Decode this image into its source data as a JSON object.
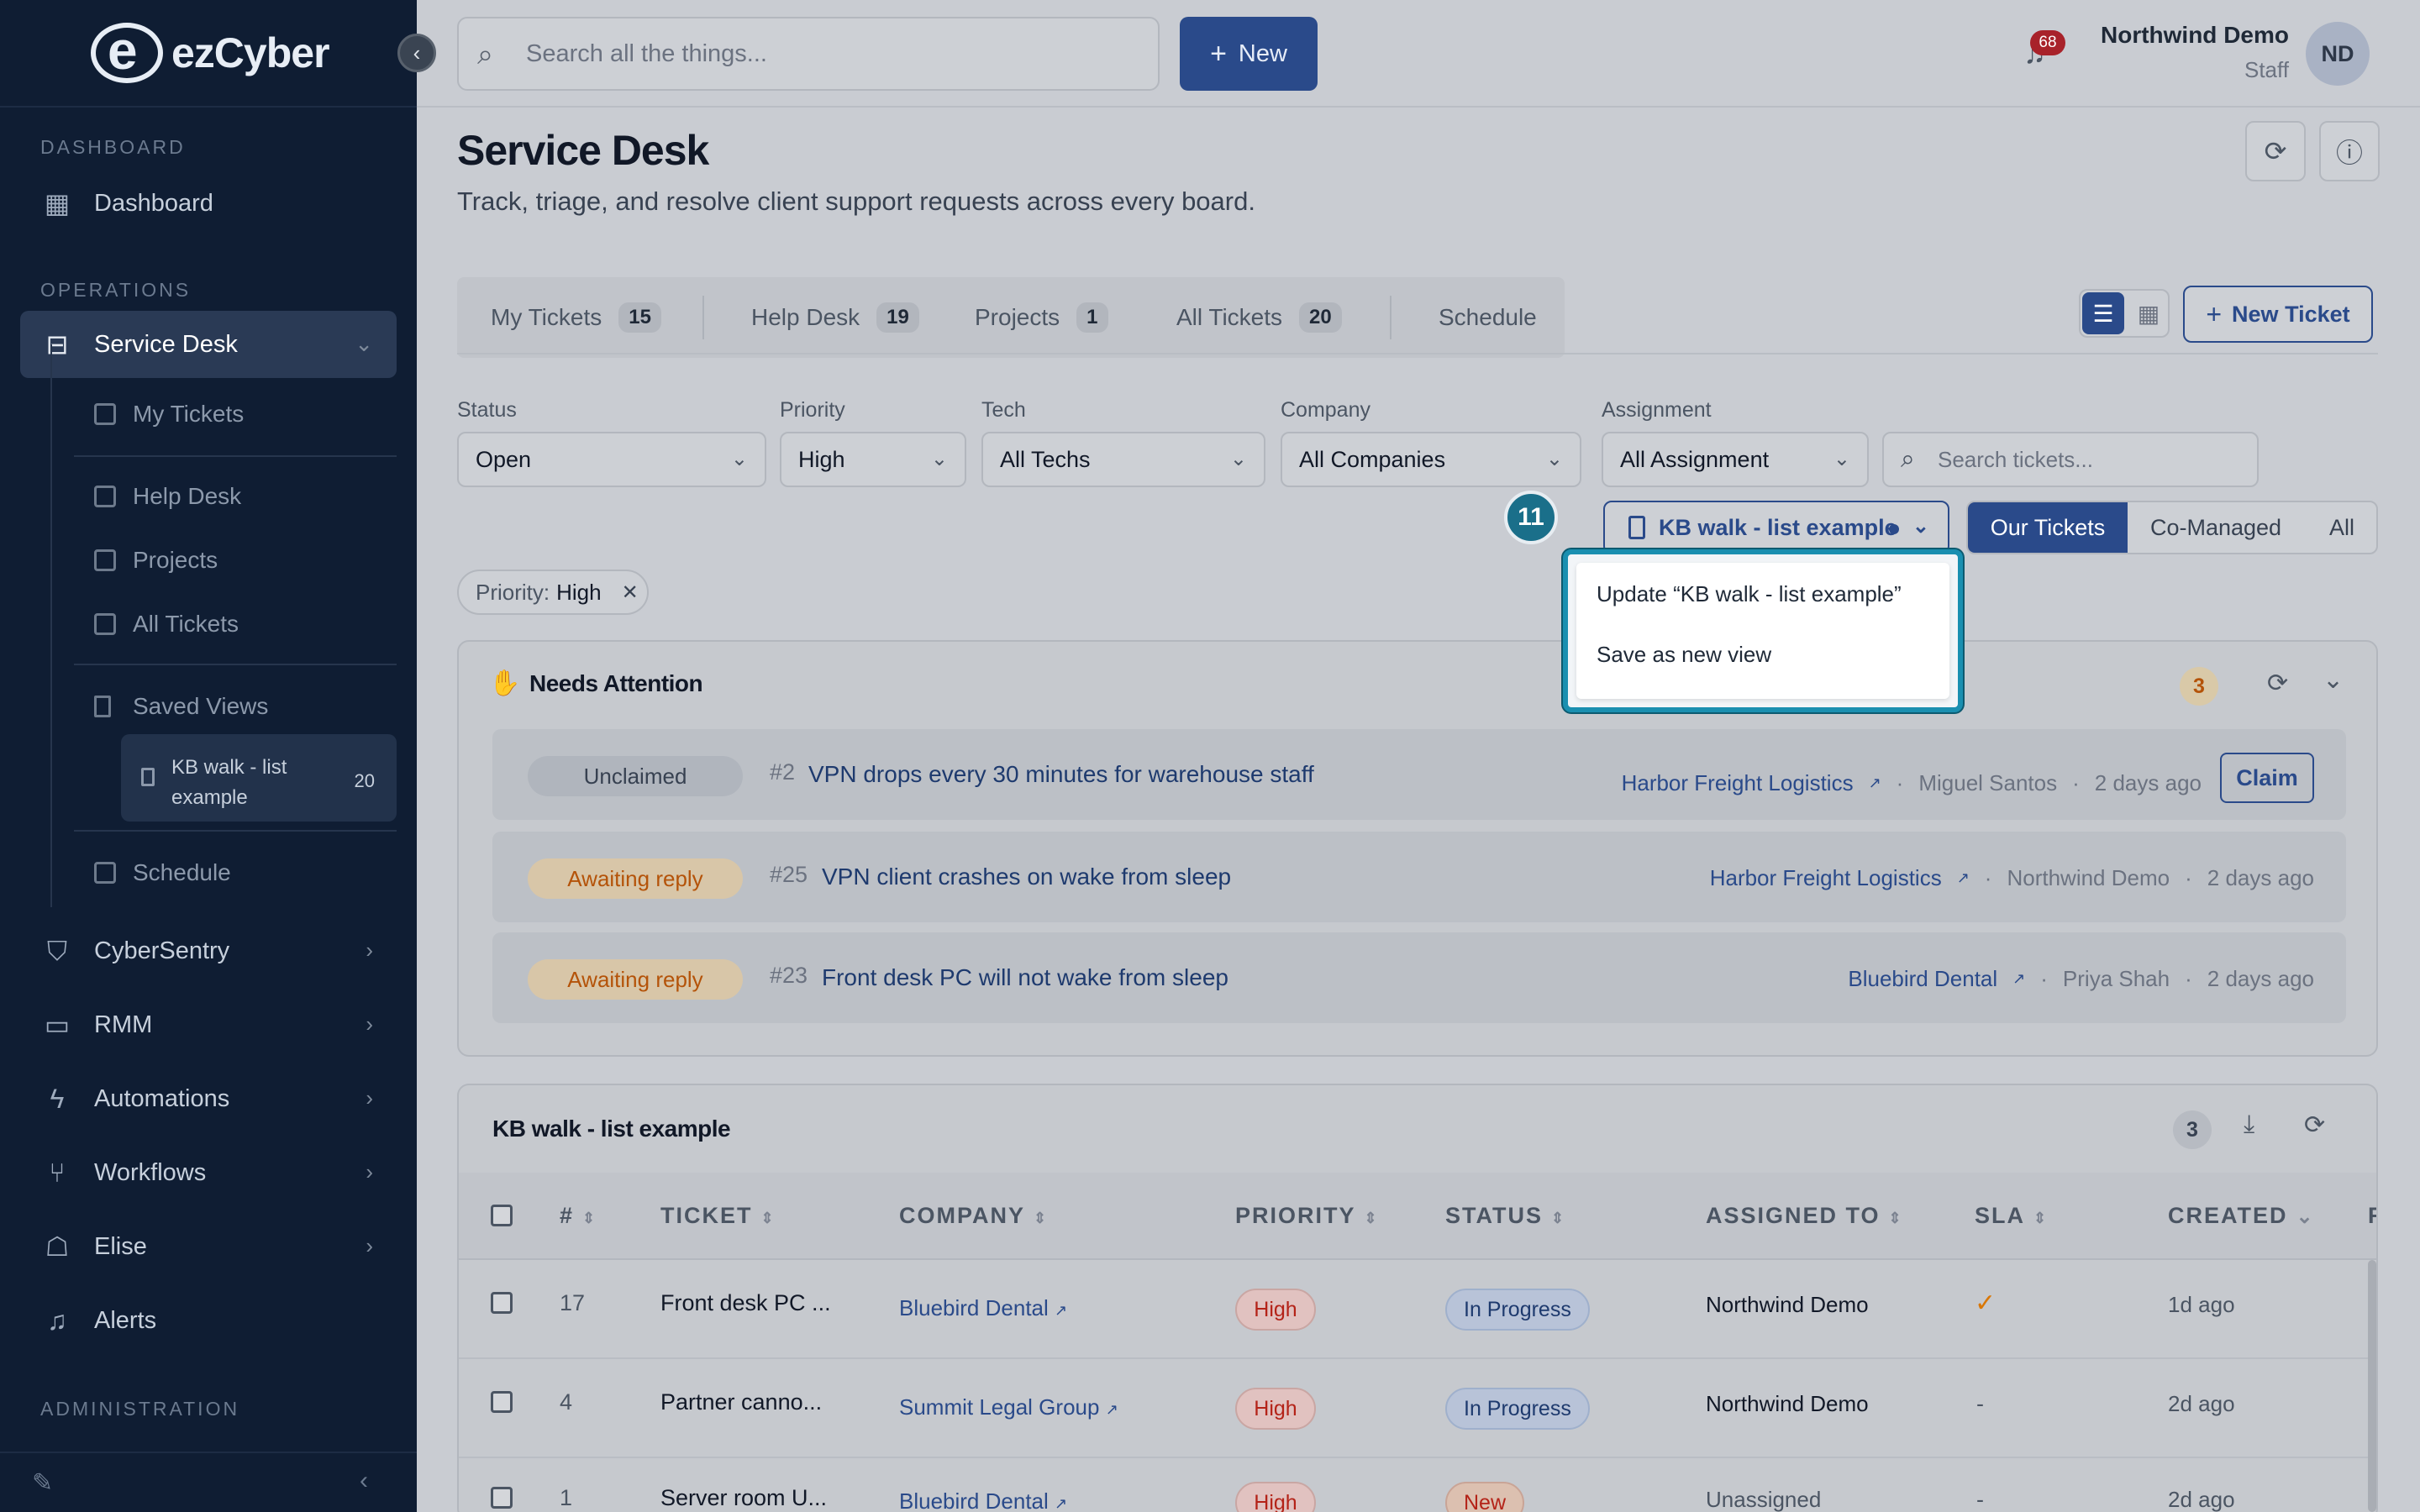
{
  "sidebar": {
    "brand": "ezCyber",
    "sections": {
      "dashboard": "DASHBOARD",
      "operations": "OPERATIONS",
      "administration": "ADMINISTRATION"
    },
    "items": {
      "dashboard": "Dashboard",
      "service_desk": "Service Desk",
      "my_tickets": "My Tickets",
      "help_desk": "Help Desk",
      "projects": "Projects",
      "all_tickets": "All Tickets",
      "saved_views": "Saved Views",
      "saved_view_item": "KB walk - list example",
      "saved_view_count": "20",
      "schedule": "Schedule",
      "cybersentry": "CyberSentry",
      "rmm": "RMM",
      "automations": "Automations",
      "workflows": "Workflows",
      "elise": "Elise",
      "alerts": "Alerts"
    }
  },
  "topbar": {
    "search_placeholder": "Search all the things...",
    "new_label": "New",
    "notifications": "68",
    "user_name": "Northwind Demo",
    "user_role": "Staff",
    "avatar": "ND"
  },
  "page": {
    "title": "Service Desk",
    "subtitle": "Track, triage, and resolve client support requests across every board."
  },
  "tabs": [
    {
      "label": "My Tickets",
      "count": "15"
    },
    {
      "label": "Help Desk",
      "count": "19"
    },
    {
      "label": "Projects",
      "count": "1"
    },
    {
      "label": "All Tickets",
      "count": "20"
    },
    {
      "label": "Schedule"
    }
  ],
  "new_ticket_label": "New Ticket",
  "filters": {
    "status": {
      "label": "Status",
      "value": "Open"
    },
    "priority": {
      "label": "Priority",
      "value": "High"
    },
    "tech": {
      "label": "Tech",
      "value": "All Techs"
    },
    "company": {
      "label": "Company",
      "value": "All Companies"
    },
    "assignment": {
      "label": "Assignment",
      "value": "All Assignment"
    },
    "search_placeholder": "Search tickets..."
  },
  "step_badge": "11",
  "saved_view": {
    "label": "KB walk - list example"
  },
  "scope": {
    "our": "Our Tickets",
    "co_managed": "Co-Managed",
    "all": "All"
  },
  "active_chip": {
    "key": "Priority:",
    "value": "High"
  },
  "view_menu": {
    "update": "Update “KB walk - list example”",
    "save_new": "Save as new view"
  },
  "needs_attention": {
    "title": "Needs Attention",
    "count": "3",
    "rows": [
      {
        "status": "Unclaimed",
        "num": "#2",
        "title": "VPN drops every 30 minutes for warehouse staff",
        "company": "Harbor Freight Logistics",
        "person": "Miguel Santos",
        "time": "2 days ago",
        "action": "Claim"
      },
      {
        "status": "Awaiting reply",
        "num": "#25",
        "title": "VPN client crashes on wake from sleep",
        "company": "Harbor Freight Logistics",
        "person": "Northwind Demo",
        "time": "2 days ago"
      },
      {
        "status": "Awaiting reply",
        "num": "#23",
        "title": "Front desk PC will not wake from sleep",
        "company": "Bluebird Dental",
        "person": "Priya Shah",
        "time": "2 days ago"
      }
    ]
  },
  "list": {
    "title": "KB walk - list example",
    "count": "3",
    "columns": {
      "num": "#",
      "ticket": "TICKET",
      "company": "COMPANY",
      "priority": "PRIORITY",
      "status": "STATUS",
      "assigned": "ASSIGNED TO",
      "sla": "SLA",
      "created": "CREATED",
      "extra": "R"
    },
    "rows": [
      {
        "num": "17",
        "ticket": "Front desk PC ...",
        "company": "Bluebird Dental",
        "priority": "High",
        "status": "In Progress",
        "assigned": "Northwind Demo",
        "sla": "",
        "created": "1d ago"
      },
      {
        "num": "4",
        "ticket": "Partner canno...",
        "company": "Summit Legal Group",
        "priority": "High",
        "status": "In Progress",
        "assigned": "Northwind Demo",
        "sla": "-",
        "created": "2d ago"
      },
      {
        "num": "1",
        "ticket": "Server room U...",
        "company": "Bluebird Dental",
        "priority": "High",
        "status": "New",
        "assigned": "Unassigned",
        "sla": "-",
        "created": "2d ago"
      }
    ]
  },
  "colors": {
    "brand": "#2a4a8a",
    "sidebar": "#0f1d33",
    "highlight": "#1a8fb0",
    "danger": "#b42318",
    "warning": "#d97706"
  }
}
